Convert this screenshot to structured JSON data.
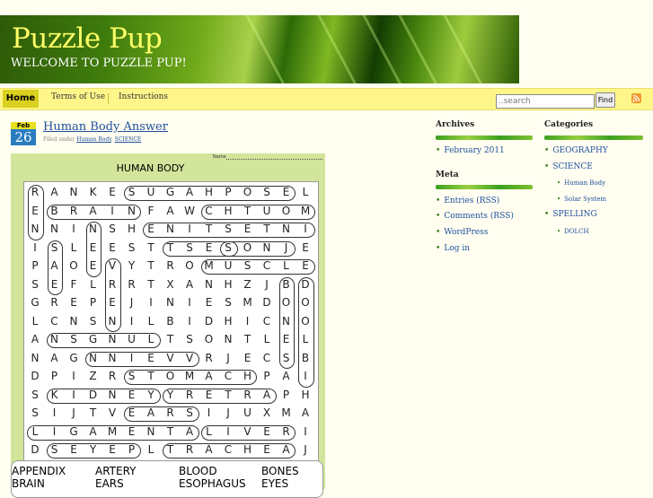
{
  "header": {
    "title": "Puzzle Pup",
    "description": "WELCOME TO PUZZLE PUP!"
  },
  "nav": {
    "items": [
      "Home",
      "Terms of Use",
      "Instructions"
    ],
    "active": "Home"
  },
  "search": {
    "placeholder": "..search",
    "button": "Find"
  },
  "post": {
    "month": "Feb",
    "day": "26",
    "title": "Human Body Answer",
    "filed_prefix": "Filed under",
    "categories": [
      "Human Body",
      "SCIENCE"
    ]
  },
  "puzzle": {
    "name_label": "Name",
    "title": "HUMAN BODY",
    "grid": [
      "RANKESUGAHPOSEL",
      "EBRAINFAWCHTUOM",
      "NNINSHENITSETNI",
      "ISLEESTTSESONJE",
      "PAOEVYTROMUSCLE",
      "SEFLRRTXANHZJBD",
      "GREPEJINIESMDOO",
      "LCNSNILBIDHICNO",
      "ANSGNULTSONTLEL",
      "NAGNNIEVVRJECSB",
      "DPIZRSTOMACHPAI",
      "SKIDNEYYRETRAPH",
      "SIJTVEARSIJUXMA",
      "LIGAMENTALIVERI",
      "DSEYEPLTRACHEAJ"
    ],
    "words": [
      "APPENDIX",
      "ARTERY",
      "BLOOD",
      "BONES",
      "BRAIN",
      "EARS",
      "ESOPHAGUS",
      "EYES"
    ]
  },
  "sidebar": {
    "archives": {
      "heading": "Archives",
      "items": [
        "February 2011"
      ]
    },
    "meta": {
      "heading": "Meta",
      "items": [
        "Entries (RSS)",
        "Comments (RSS)",
        "WordPress",
        "Log in"
      ]
    },
    "categories": {
      "heading": "Categories",
      "items": [
        {
          "label": "GEOGRAPHY",
          "sub": []
        },
        {
          "label": "SCIENCE",
          "sub": [
            "Human Body",
            "Solar System"
          ]
        },
        {
          "label": "SPELLING",
          "sub": [
            "DOLCH"
          ]
        }
      ]
    }
  },
  "colors": {
    "accent": "#2050a0",
    "nav_bg": "#fff68a",
    "puzzle_bg": "#d2e59b",
    "date_blue": "#2a7cc0"
  },
  "icons": {
    "feed": "rss-icon"
  }
}
